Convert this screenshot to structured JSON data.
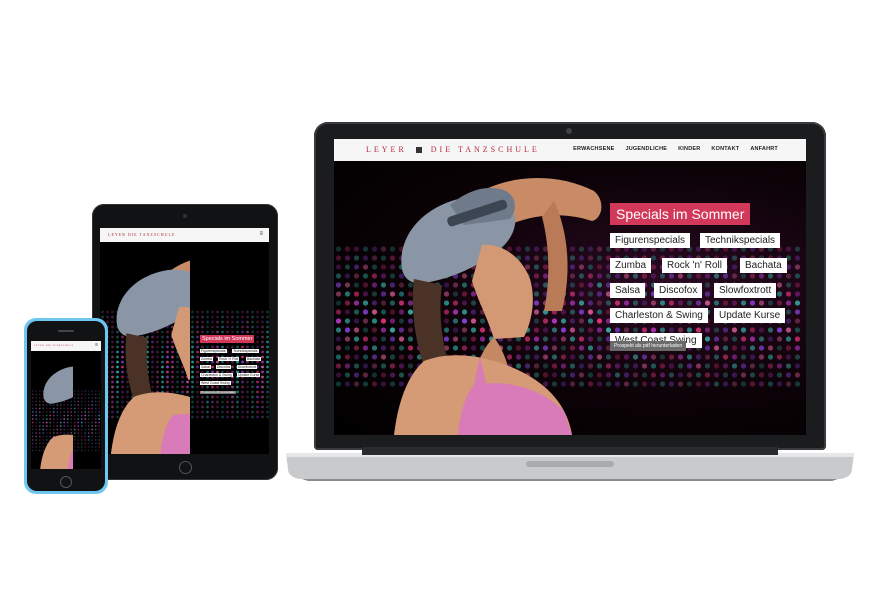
{
  "site": {
    "brand_left": "LEYER",
    "brand_right": "DIE TANZSCHULE",
    "menu": [
      "ERWACHSENE",
      "JUGENDLICHE",
      "KINDER",
      "KONTAKT",
      "ANFAHRT"
    ],
    "burger": "≡"
  },
  "promo": {
    "title": "Specials im Sommer",
    "tags": [
      "Figurenspecials",
      "Technikspecials",
      "Zumba",
      "Rock 'n' Roll",
      "Bachata",
      "Salsa",
      "Discofox",
      "Slowfoxtrott",
      "Charleston & Swing",
      "Update Kurse",
      "West Coast Swing"
    ],
    "pdf_button": "Prospekt als pdf herunterladen"
  },
  "colors": {
    "accent": "#d2385a",
    "brand": "#b52a3e",
    "phone_shell": "#6fc7ef"
  }
}
